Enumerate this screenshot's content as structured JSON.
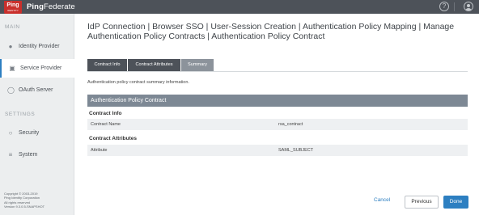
{
  "header": {
    "logo_text": "Ping",
    "logo_subtext": "IDENTITY",
    "brand_bold": "Ping",
    "brand_light": "Federate",
    "help_icon": "help-circle-icon",
    "user_icon": "user-circle-icon"
  },
  "sidebar": {
    "section_main": "MAIN",
    "section_settings": "SETTINGS",
    "items": [
      {
        "label": "Identity Provider",
        "icon": "identity-provider-icon"
      },
      {
        "label": "Service Provider",
        "icon": "service-provider-icon",
        "active": true
      },
      {
        "label": "OAuth Server",
        "icon": "oauth-icon"
      },
      {
        "label": "Security",
        "icon": "security-icon"
      },
      {
        "label": "System",
        "icon": "system-icon"
      }
    ],
    "copyright": [
      "Copyright © 2003-2019",
      "Ping Identity Corporation",
      "All rights reserved",
      "Version 9.3.0.5-SNAPSHOT"
    ]
  },
  "main": {
    "breadcrumb": "IdP Connection | Browser SSO | User-Session Creation | Authentication Policy Mapping | Manage Authentication Policy Contracts | Authentication Policy Contract",
    "tabs": [
      "Contract Info",
      "Contract Attributes",
      "Summary"
    ],
    "description": "Authentication policy contract summary information.",
    "section_title": "Authentication Policy Contract",
    "contract_info_title": "Contract Info",
    "contract_name_key": "Contract Name",
    "contract_name_value": "rsa_contract",
    "contract_attributes_title": "Contract Attributes",
    "attribute_key": "Attribute",
    "attribute_value": "SAML_SUBJECT"
  },
  "footer": {
    "cancel_label": "Cancel",
    "previous_label": "Previous",
    "done_label": "Done"
  },
  "colors": {
    "topbar": "#4d5259",
    "logo_red": "#c9302c",
    "accent_blue": "#2d7fc1",
    "section_header": "#7d8894"
  }
}
